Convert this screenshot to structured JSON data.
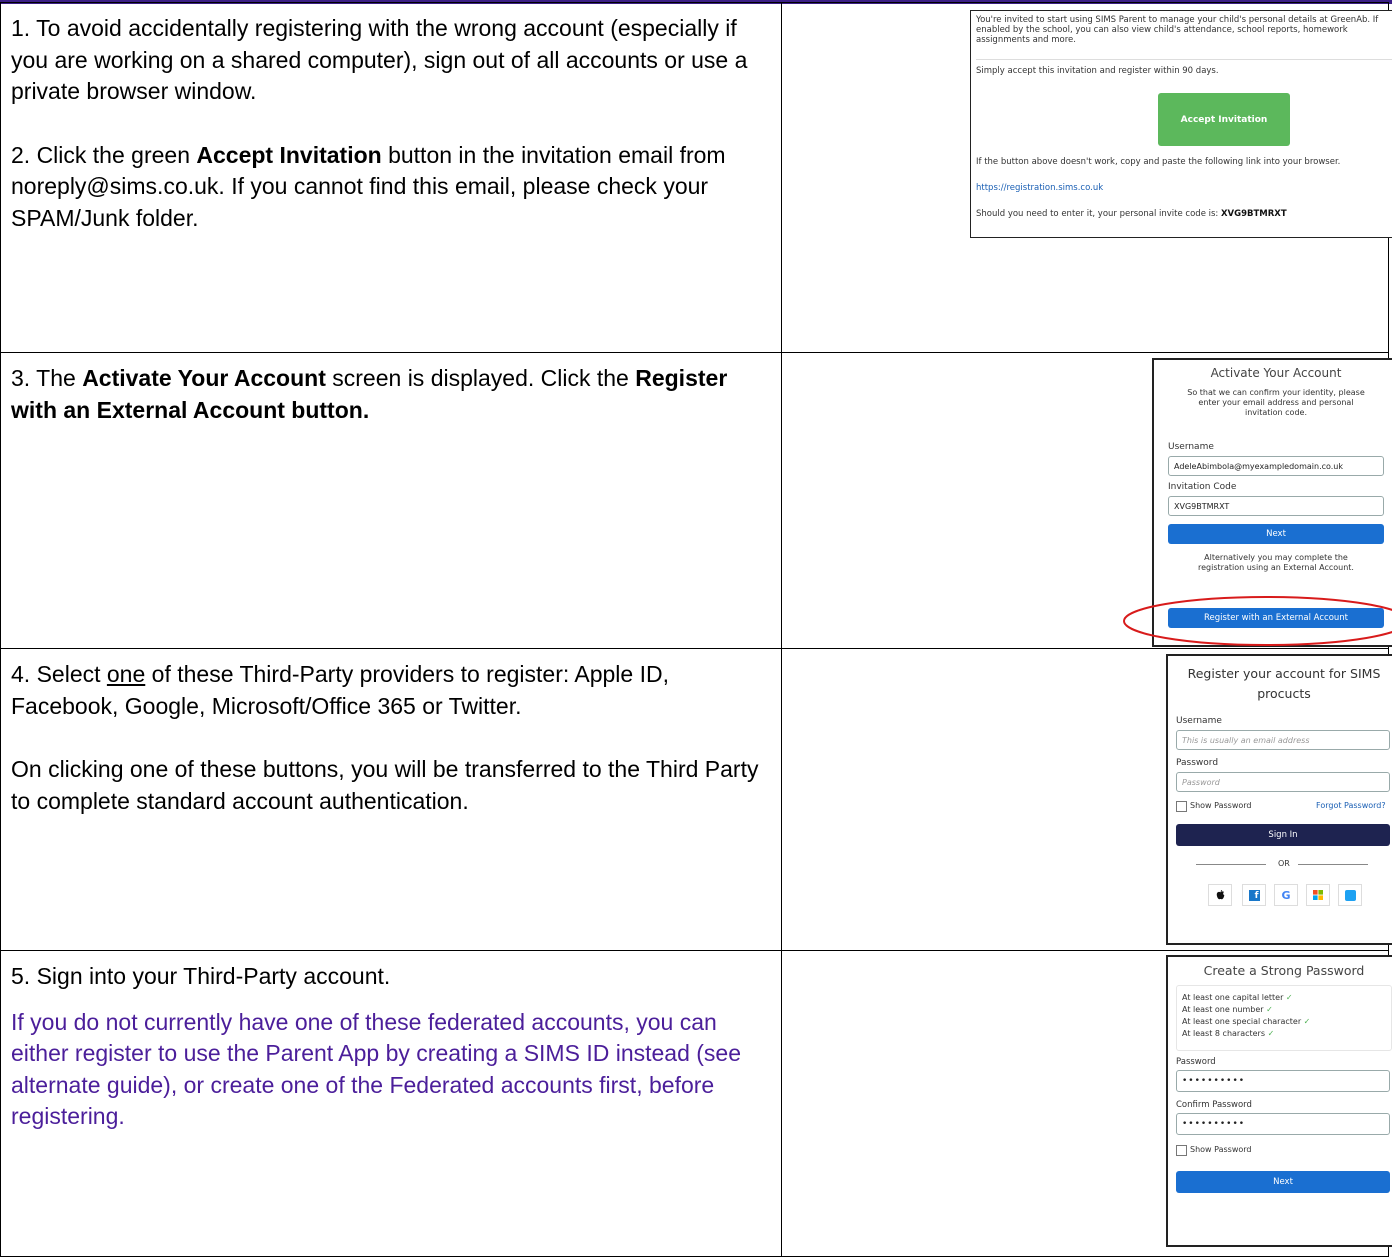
{
  "row1": {
    "step1": "1. To avoid accidentally registering with the wrong account (especially if you are working on a shared computer), sign out of all accounts or use a private browser window.",
    "step2_pre": "2. Click the green ",
    "step2_bold": "Accept Invitation",
    "step2_post": " button in the invitation email from noreply@sims.co.uk. If you cannot find this email, please check your SPAM/Junk folder.",
    "email": {
      "intro": "You're invited to start using SIMS Parent to manage your child's personal details at GreenAb. If enabled by the school, you can also view child's attendance, school reports, homework assignments and more.",
      "accept_text": "Simply accept this invitation and register within 90 days.",
      "button_label": "Accept Invitation",
      "fallback_text": "If the button above doesn't work, copy and paste the following link into your browser.",
      "link": "https://registration.sims.co.uk",
      "code_text": "Should you need to enter it, your personal invite code is:",
      "code": "XVG9BTMRXT"
    }
  },
  "row2": {
    "step3_pre": "3. The ",
    "step3_bold1": "Activate Your Account",
    "step3_mid": " screen is displayed. Click the ",
    "step3_bold2": "Register with an External Account button.",
    "activate": {
      "title": "Activate Your Account",
      "subtitle": "So that we can confirm your identity, please enter your email address and personal invitation code.",
      "username_label": "Username",
      "username_value": "AdeleAbimbola@myexampledomain.co.uk",
      "code_label": "Invitation Code",
      "code_value": "XVG9BTMRXT",
      "next_label": "Next",
      "alt_text": "Alternatively you may complete the registration using an External Account.",
      "external_label": "Register with an External Account"
    }
  },
  "row3": {
    "step4_pre": "4.  Select ",
    "step4_u": "one",
    "step4_post": " of these Third-Party providers to register: Apple ID, Facebook, Google, Microsoft/Office 365 or Twitter.",
    "step4_b": "On clicking one of these buttons, you will be transferred to the Third Party to complete standard account authentication.",
    "register": {
      "title": "Register your account for SIMS procucts",
      "username_label": "Username",
      "username_placeholder": "This is usually an email address",
      "password_label": "Password",
      "password_placeholder": "Password",
      "show_password": "Show Password",
      "forgot": "Forgot Password?",
      "signin_label": "Sign In",
      "or": "OR"
    }
  },
  "row4": {
    "step5": "5.  Sign into your Third-Party account.",
    "note": "If you do not currently have one of these federated accounts, you can either register to use the Parent App by creating a SIMS ID instead (see alternate guide), or create one of the Federated accounts first, before registering.",
    "password": {
      "title": "Create a Strong Password",
      "rules": [
        "At least one capital letter",
        "At least one number",
        "At least one special character",
        "At least 8 characters"
      ],
      "password_label": "Password",
      "password_value": "••••••••••",
      "confirm_label": "Confirm Password",
      "confirm_value": "••••••••••",
      "show_password": "Show Password",
      "next_label": "Next"
    }
  },
  "colors": {
    "green_button": "#5cb85c",
    "blue_button": "#1a6fd1",
    "navy_button": "#1e2350",
    "note_purple": "#4b1e9a",
    "highlight_red": "#d81b1b"
  }
}
